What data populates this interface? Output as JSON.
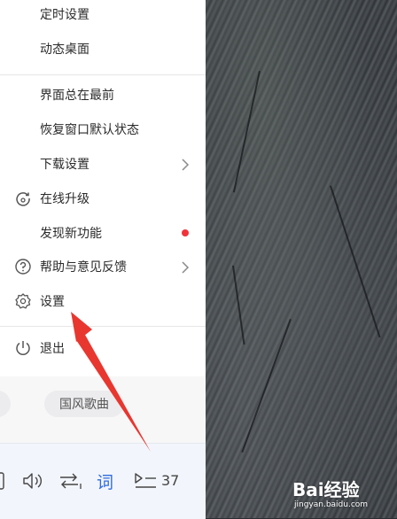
{
  "menu": {
    "items": [
      {
        "label": "定时设置"
      },
      {
        "label": "动态桌面"
      },
      {
        "label": "界面总在最前"
      },
      {
        "label": "恢复窗口默认状态"
      },
      {
        "label": "下载设置"
      },
      {
        "label": "在线升级",
        "icon": "upgrade-icon"
      },
      {
        "label": "发现新功能"
      },
      {
        "label": "帮助与意见反馈",
        "icon": "help-icon"
      },
      {
        "label": "设置",
        "icon": "gear-icon"
      },
      {
        "label": "退出",
        "icon": "power-icon"
      }
    ],
    "new_feature_dot_color": "#f0333a"
  },
  "tags": {
    "pill_2": "国风歌曲"
  },
  "player": {
    "lyrics_label": "词",
    "playlist_count": "37",
    "accent": "#2f6be0"
  },
  "watermark": {
    "brand": "Bai经验",
    "url": "jingyan.baidu.com"
  },
  "annotation": {
    "arrow_color": "#e8372f"
  }
}
